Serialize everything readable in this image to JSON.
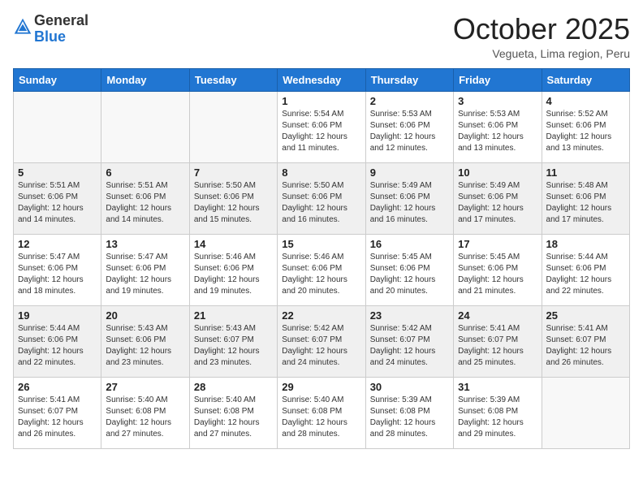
{
  "header": {
    "logo_general": "General",
    "logo_blue": "Blue",
    "month_title": "October 2025",
    "location": "Vegueta, Lima region, Peru"
  },
  "days_of_week": [
    "Sunday",
    "Monday",
    "Tuesday",
    "Wednesday",
    "Thursday",
    "Friday",
    "Saturday"
  ],
  "weeks": [
    [
      {
        "day": "",
        "detail": ""
      },
      {
        "day": "",
        "detail": ""
      },
      {
        "day": "",
        "detail": ""
      },
      {
        "day": "1",
        "detail": "Sunrise: 5:54 AM\nSunset: 6:06 PM\nDaylight: 12 hours\nand 11 minutes."
      },
      {
        "day": "2",
        "detail": "Sunrise: 5:53 AM\nSunset: 6:06 PM\nDaylight: 12 hours\nand 12 minutes."
      },
      {
        "day": "3",
        "detail": "Sunrise: 5:53 AM\nSunset: 6:06 PM\nDaylight: 12 hours\nand 13 minutes."
      },
      {
        "day": "4",
        "detail": "Sunrise: 5:52 AM\nSunset: 6:06 PM\nDaylight: 12 hours\nand 13 minutes."
      }
    ],
    [
      {
        "day": "5",
        "detail": "Sunrise: 5:51 AM\nSunset: 6:06 PM\nDaylight: 12 hours\nand 14 minutes."
      },
      {
        "day": "6",
        "detail": "Sunrise: 5:51 AM\nSunset: 6:06 PM\nDaylight: 12 hours\nand 14 minutes."
      },
      {
        "day": "7",
        "detail": "Sunrise: 5:50 AM\nSunset: 6:06 PM\nDaylight: 12 hours\nand 15 minutes."
      },
      {
        "day": "8",
        "detail": "Sunrise: 5:50 AM\nSunset: 6:06 PM\nDaylight: 12 hours\nand 16 minutes."
      },
      {
        "day": "9",
        "detail": "Sunrise: 5:49 AM\nSunset: 6:06 PM\nDaylight: 12 hours\nand 16 minutes."
      },
      {
        "day": "10",
        "detail": "Sunrise: 5:49 AM\nSunset: 6:06 PM\nDaylight: 12 hours\nand 17 minutes."
      },
      {
        "day": "11",
        "detail": "Sunrise: 5:48 AM\nSunset: 6:06 PM\nDaylight: 12 hours\nand 17 minutes."
      }
    ],
    [
      {
        "day": "12",
        "detail": "Sunrise: 5:47 AM\nSunset: 6:06 PM\nDaylight: 12 hours\nand 18 minutes."
      },
      {
        "day": "13",
        "detail": "Sunrise: 5:47 AM\nSunset: 6:06 PM\nDaylight: 12 hours\nand 19 minutes."
      },
      {
        "day": "14",
        "detail": "Sunrise: 5:46 AM\nSunset: 6:06 PM\nDaylight: 12 hours\nand 19 minutes."
      },
      {
        "day": "15",
        "detail": "Sunrise: 5:46 AM\nSunset: 6:06 PM\nDaylight: 12 hours\nand 20 minutes."
      },
      {
        "day": "16",
        "detail": "Sunrise: 5:45 AM\nSunset: 6:06 PM\nDaylight: 12 hours\nand 20 minutes."
      },
      {
        "day": "17",
        "detail": "Sunrise: 5:45 AM\nSunset: 6:06 PM\nDaylight: 12 hours\nand 21 minutes."
      },
      {
        "day": "18",
        "detail": "Sunrise: 5:44 AM\nSunset: 6:06 PM\nDaylight: 12 hours\nand 22 minutes."
      }
    ],
    [
      {
        "day": "19",
        "detail": "Sunrise: 5:44 AM\nSunset: 6:06 PM\nDaylight: 12 hours\nand 22 minutes."
      },
      {
        "day": "20",
        "detail": "Sunrise: 5:43 AM\nSunset: 6:06 PM\nDaylight: 12 hours\nand 23 minutes."
      },
      {
        "day": "21",
        "detail": "Sunrise: 5:43 AM\nSunset: 6:07 PM\nDaylight: 12 hours\nand 23 minutes."
      },
      {
        "day": "22",
        "detail": "Sunrise: 5:42 AM\nSunset: 6:07 PM\nDaylight: 12 hours\nand 24 minutes."
      },
      {
        "day": "23",
        "detail": "Sunrise: 5:42 AM\nSunset: 6:07 PM\nDaylight: 12 hours\nand 24 minutes."
      },
      {
        "day": "24",
        "detail": "Sunrise: 5:41 AM\nSunset: 6:07 PM\nDaylight: 12 hours\nand 25 minutes."
      },
      {
        "day": "25",
        "detail": "Sunrise: 5:41 AM\nSunset: 6:07 PM\nDaylight: 12 hours\nand 26 minutes."
      }
    ],
    [
      {
        "day": "26",
        "detail": "Sunrise: 5:41 AM\nSunset: 6:07 PM\nDaylight: 12 hours\nand 26 minutes."
      },
      {
        "day": "27",
        "detail": "Sunrise: 5:40 AM\nSunset: 6:08 PM\nDaylight: 12 hours\nand 27 minutes."
      },
      {
        "day": "28",
        "detail": "Sunrise: 5:40 AM\nSunset: 6:08 PM\nDaylight: 12 hours\nand 27 minutes."
      },
      {
        "day": "29",
        "detail": "Sunrise: 5:40 AM\nSunset: 6:08 PM\nDaylight: 12 hours\nand 28 minutes."
      },
      {
        "day": "30",
        "detail": "Sunrise: 5:39 AM\nSunset: 6:08 PM\nDaylight: 12 hours\nand 28 minutes."
      },
      {
        "day": "31",
        "detail": "Sunrise: 5:39 AM\nSunset: 6:08 PM\nDaylight: 12 hours\nand 29 minutes."
      },
      {
        "day": "",
        "detail": ""
      }
    ]
  ]
}
